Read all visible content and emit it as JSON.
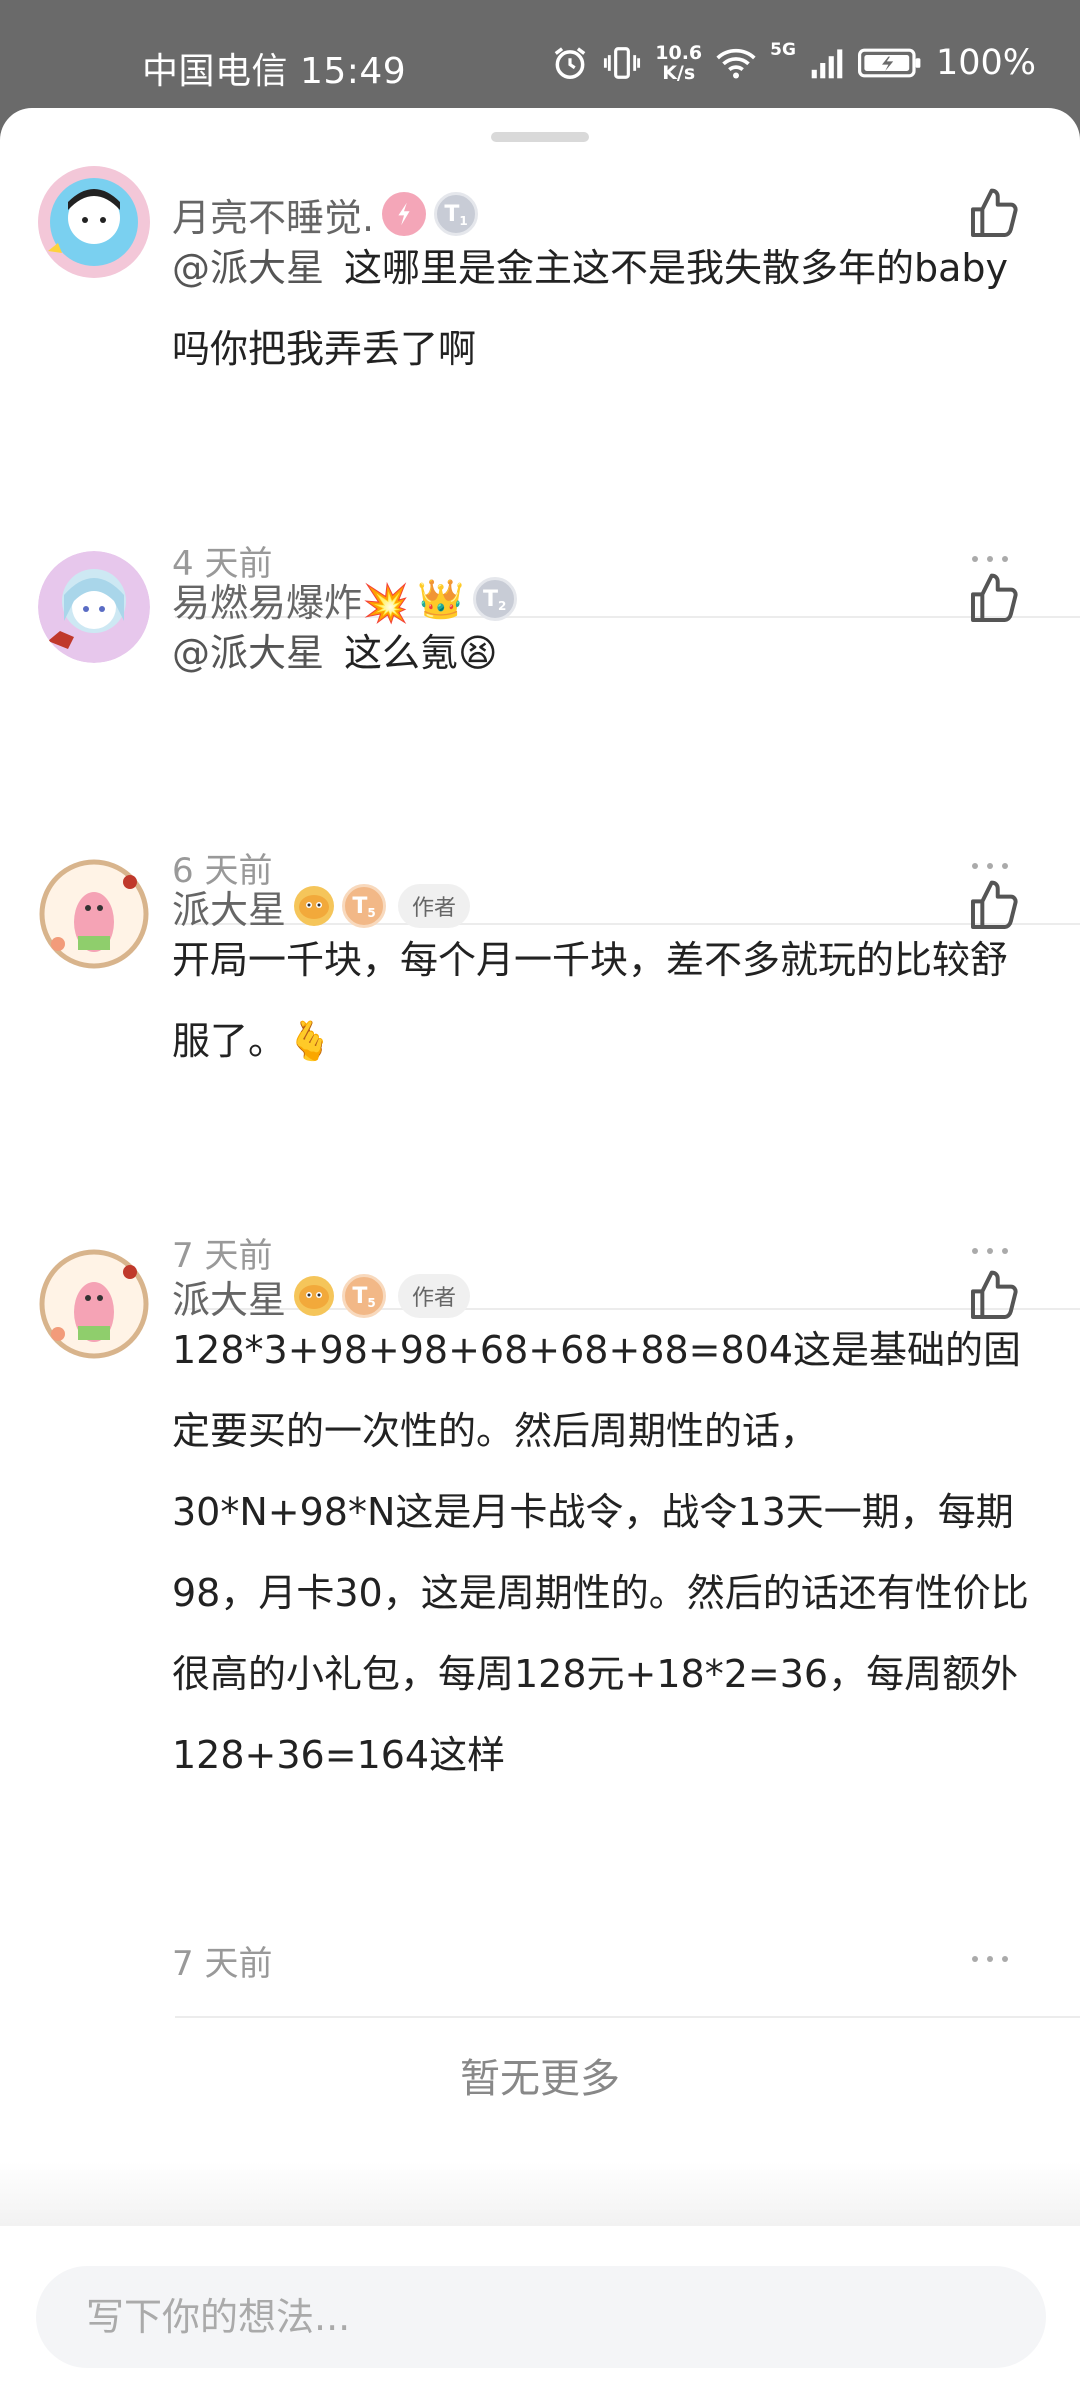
{
  "status_bar": {
    "carrier_time": "中国电信 15:49",
    "net_speed_value": "10.6",
    "net_speed_unit": "K/s",
    "signal": "5G",
    "battery": "100%"
  },
  "comments": [
    {
      "username": "月亮不睡觉.",
      "level": "T",
      "level_sub": "1",
      "mention": "@派大星",
      "text": "这哪里是金主这不是我失散多年的baby吗你把我弄丢了啊",
      "time": "4 天前"
    },
    {
      "username": "易燃易爆炸💥",
      "crown": "👑",
      "level": "T",
      "level_sub": "2",
      "mention": "@派大星",
      "text": "这么氪😫",
      "time": "6 天前"
    },
    {
      "username": "派大星",
      "level": "T",
      "level_sub": "5",
      "author_tag": "作者",
      "text": "开局一千块，每个月一千块，差不多就玩的比较舒服了。🫰",
      "time": "7 天前"
    },
    {
      "username": "派大星",
      "level": "T",
      "level_sub": "5",
      "author_tag": "作者",
      "text": "128*3+98+98+68+68+88=804这是基础的固定要买的一次性的。然后周期性的话，30*N+98*N这是月卡战令，战令13天一期，每期98，月卡30，这是周期性的。然后的话还有性价比很高的小礼包，每周128元+18*2=36，每周额外128+36=164这样",
      "time": "7 天前"
    }
  ],
  "no_more_text": "暂无更多",
  "input": {
    "placeholder": "写下你的想法..."
  },
  "colors": {
    "status_bar": "#6a6a6a",
    "sheet": "#ffffff",
    "muted_text": "#999999"
  }
}
